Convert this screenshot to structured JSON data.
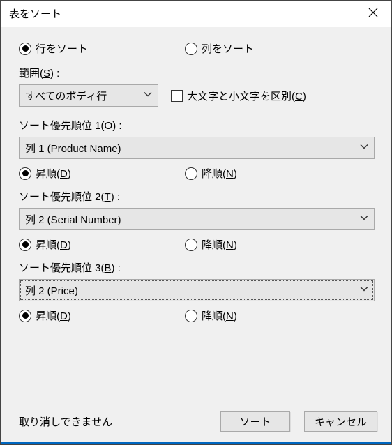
{
  "title": "表をソート",
  "sortTarget": {
    "rowsLabel": "行をソート",
    "colsLabel": "列をソート",
    "rowsSelected": true
  },
  "range": {
    "label_pre": "範囲(",
    "label_key": "S",
    "label_post": ") :",
    "value": "すべてのボディ行"
  },
  "caseSensitive": {
    "label_pre": "大文字と小文字を区別(",
    "label_key": "C",
    "label_post": ")",
    "checked": false
  },
  "priorities": [
    {
      "label_pre": "ソート優先順位 1(",
      "label_key": "O",
      "label_post": ") :",
      "value": "列 1  (Product Name)",
      "focused": false
    },
    {
      "label_pre": "ソート優先順位 2(",
      "label_key": "T",
      "label_post": ") :",
      "value": "列 2  (Serial Number)",
      "focused": false
    },
    {
      "label_pre": "ソート優先順位 3(",
      "label_key": "B",
      "label_post": ") :",
      "value": "列 2  (Price)",
      "focused": true
    }
  ],
  "order": {
    "asc_pre": "昇順(",
    "asc_key": "D",
    "asc_post": ")",
    "desc_pre": "降順(",
    "desc_key": "N",
    "desc_post": ")"
  },
  "footer": {
    "message": "取り消しできません",
    "sort": "ソート",
    "cancel": "キャンセル"
  }
}
